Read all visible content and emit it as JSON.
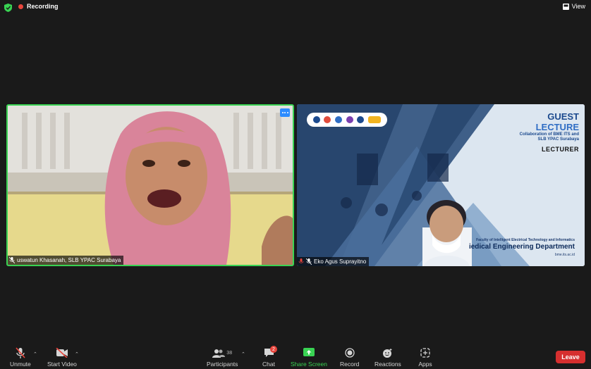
{
  "topbar": {
    "recording_label": "Recording",
    "view_label": "View"
  },
  "participants_view": {
    "left": {
      "name": "uswatun Khasanah, SLB YPAC Surabaya",
      "active_speaker": true
    },
    "right": {
      "name": "Eko Agus Suprayitno"
    }
  },
  "slide": {
    "title_line1": "GUEST",
    "title_line2": "LECTURE",
    "subtitle_line1": "Collaboration of BME ITS and",
    "subtitle_line2": "SLB YPAC Surabaya",
    "role": "LECTURER",
    "faculty": "Faculty of Intelligent Electrical Technology and Informatics",
    "department": "iedical Engineering Department",
    "url": "bme.its.ac.id"
  },
  "toolbar": {
    "unmute_label": "Unmute",
    "start_video_label": "Start Video",
    "participants_label": "Participants",
    "participants_count": "38",
    "chat_label": "Chat",
    "chat_badge": "2",
    "share_label": "Share Screen",
    "record_label": "Record",
    "reactions_label": "Reactions",
    "apps_label": "Apps",
    "leave_label": "Leave"
  },
  "colors": {
    "accent_green": "#39d353",
    "recording_red": "#e8453c",
    "leave_red": "#d62f2f",
    "zoom_blue": "#2d8cff"
  }
}
